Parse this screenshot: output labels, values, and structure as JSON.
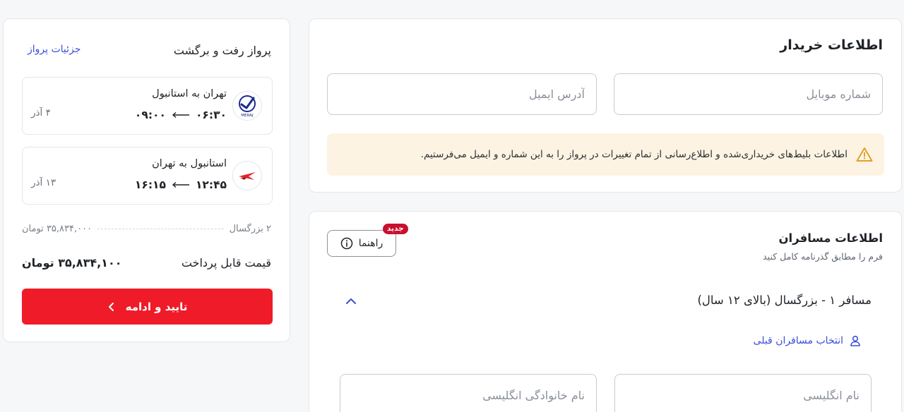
{
  "buyer": {
    "title": "اطلاعات خریدار",
    "mobile_placeholder": "شماره موبایل",
    "email_placeholder": "آدرس ایمیل",
    "notice": "اطلاعات بلیط‌های خریداری‌شده و اطلاع‌رسانی از تمام تغییرات در پرواز را به این شماره و ایمیل می‌فرستیم.",
    "notice_icon": "warning-icon",
    "notice_color": "#e0a12a"
  },
  "passengers": {
    "title": "اطلاعات مسافران",
    "subtitle": "فرم را مطابق گذرنامه کامل کنید",
    "guide_label": "راهنما",
    "guide_badge": "جدید",
    "passenger_heading": "مسافر ۱ - بزرگسال (بالای ۱۲ سال)",
    "prev_passengers_label": "انتخاب مسافران قبلی",
    "first_name_placeholder": "نام انگلیسی",
    "last_name_placeholder": "نام خانوادگی انگلیسی"
  },
  "summary": {
    "title": "پرواز رفت و برگشت",
    "details_link": "جزئیات پرواز",
    "flights": [
      {
        "route": "تهران به استانبول",
        "depart": "۰۶:۳۰",
        "arrive": "۰۹:۰۰",
        "date": "۴ آذر",
        "airline_logo_text": "MERAJ"
      },
      {
        "route": "استانبول به تهران",
        "depart": "۱۲:۴۵",
        "arrive": "۱۶:۱۵",
        "date": "۱۳ آذر"
      }
    ],
    "passenger_count": "۲ بزرگسال",
    "subtotal": "۳۵,۸۳۴,۰۰۰ تومان",
    "total_label": "قیمت قابل پرداخت",
    "total_value": "۳۵,۸۳۴,۱۰۰ تومان",
    "confirm_label": "تایید و ادامه",
    "accent_color": "#ef1b28",
    "link_color": "#3b4fd8"
  }
}
